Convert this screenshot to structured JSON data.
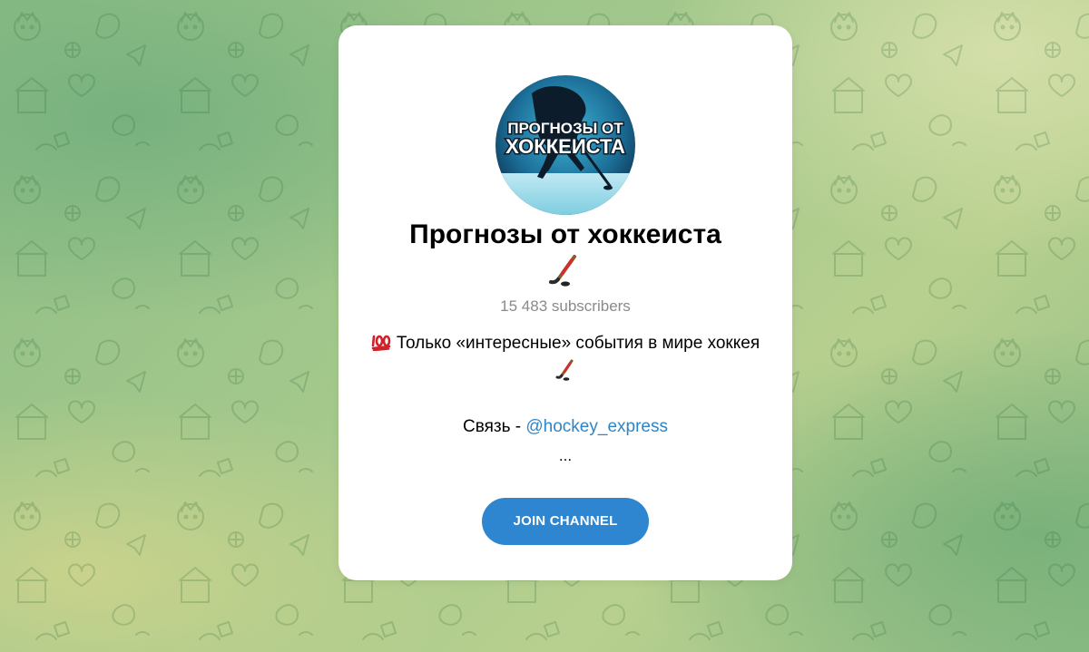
{
  "channel": {
    "title": "Прогнозы от хоккеиста",
    "subscribers": "15 483 subscribers",
    "avatar_text_line1": "ПРОГНОЗЫ ОТ",
    "avatar_text_line2": "ХОККЕИСТА"
  },
  "description": {
    "line1": "Только «интересные» события в мире хоккея",
    "contact_label": "Связь - ",
    "contact_handle": "@hockey_express",
    "ellipsis": "..."
  },
  "actions": {
    "join_label": "JOIN CHANNEL"
  },
  "colors": {
    "accent": "#2e86d0",
    "link": "#2e85c6",
    "muted": "#8a8a8a"
  },
  "icons": {
    "title_emoji": "hockey-stick-icon",
    "desc_emoji": "hundred-points-icon"
  }
}
